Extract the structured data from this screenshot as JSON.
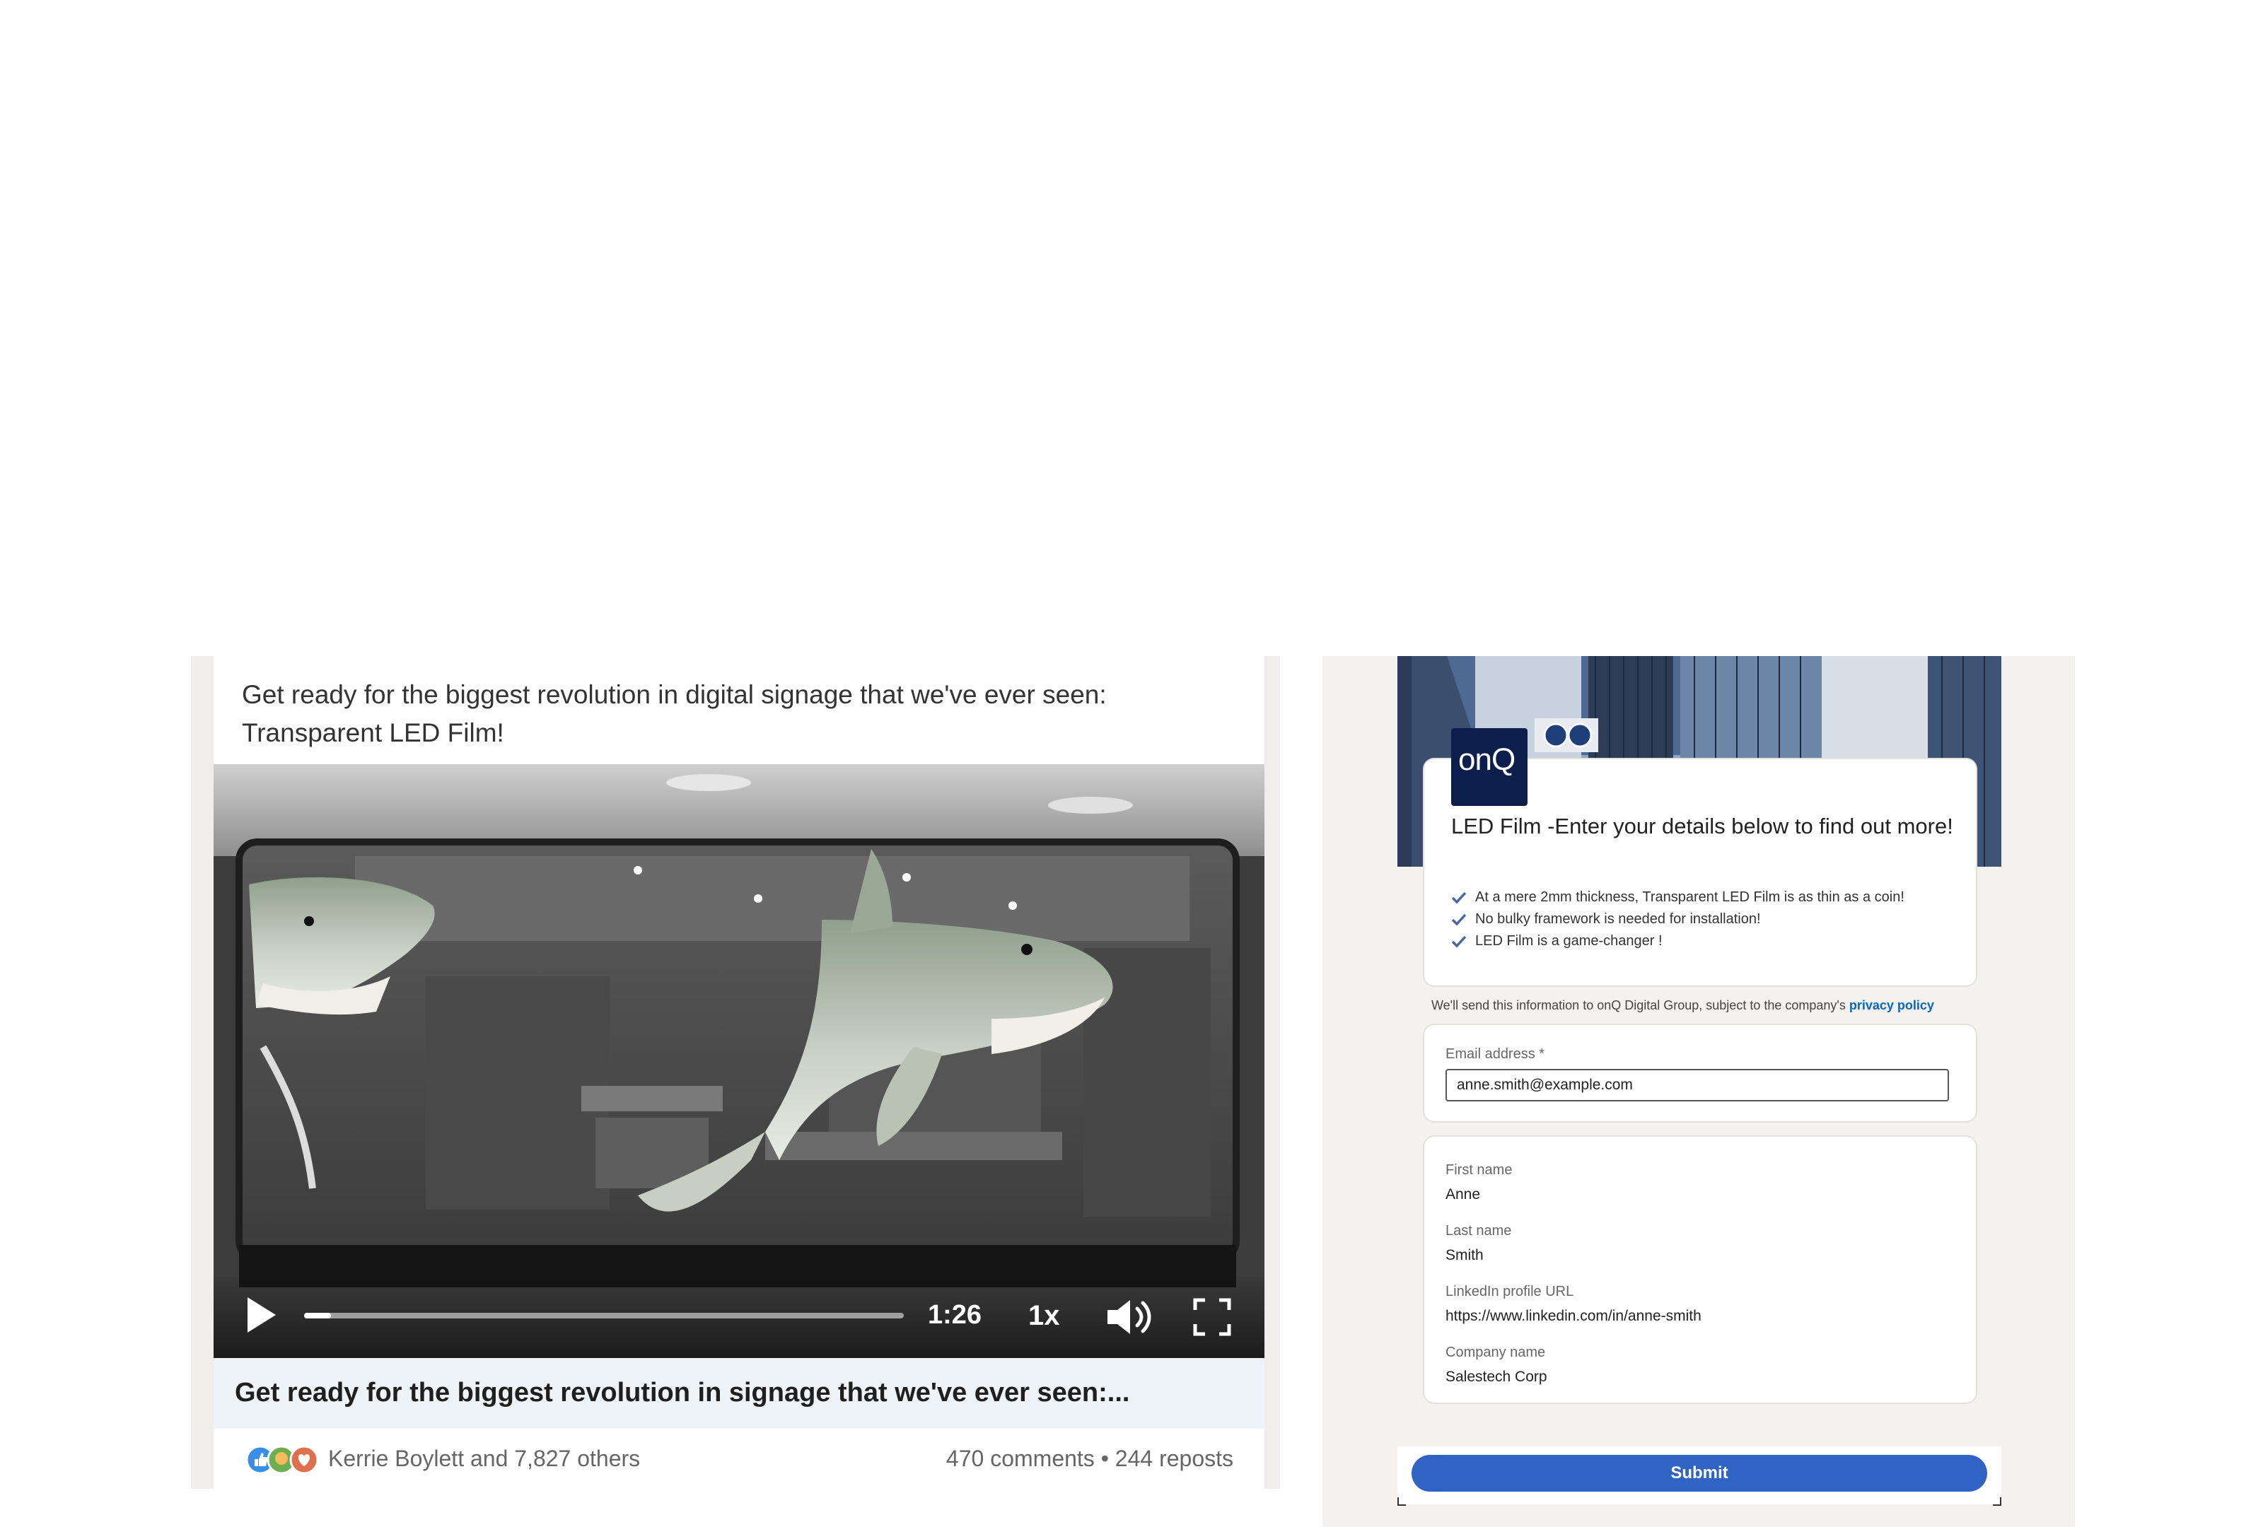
{
  "post": {
    "text": "Get ready for the biggest revolution in digital signage that we've ever seen: Transparent LED Film!",
    "video": {
      "time": "1:26",
      "speed": "1x",
      "progress": 0.045
    },
    "caption": "Get ready for the biggest revolution in signage that we've ever seen:...",
    "reactions_text": "Kerrie Boylett and 7,827 others",
    "comments": "470 comments",
    "separator": "•",
    "reposts": "244 reposts"
  },
  "form": {
    "logo": "onQ",
    "title": "LED Film -Enter your details below to find out more!",
    "bullets": [
      "At a mere 2mm thickness, Transparent LED Film is as thin as a coin!",
      "No bulky framework is needed for installation!",
      "LED Film is a game-changer !"
    ],
    "privacy_text": "We'll send this information to onQ Digital Group, subject to the company's",
    "privacy_link": "privacy policy",
    "email_label": "Email address *",
    "email_value": "anne.smith@example.com",
    "first_name_label": "First name",
    "first_name_value": "Anne",
    "last_name_label": "Last name",
    "last_name_value": "Smith",
    "linkedin_label": "LinkedIn profile URL",
    "linkedin_value": "https://www.linkedin.com/in/anne-smith",
    "company_label": "Company name",
    "company_value": "Salestech Corp",
    "submit_label": "Submit"
  },
  "colors": {
    "accent_blue": "#0a66c2",
    "submit_blue": "#2f64c4",
    "logo_navy": "#0c1e4c"
  },
  "icons": [
    "play-icon",
    "volume-icon",
    "fullscreen-icon",
    "check-icon",
    "like-reaction-icon",
    "celebrate-reaction-icon",
    "love-reaction-icon"
  ]
}
